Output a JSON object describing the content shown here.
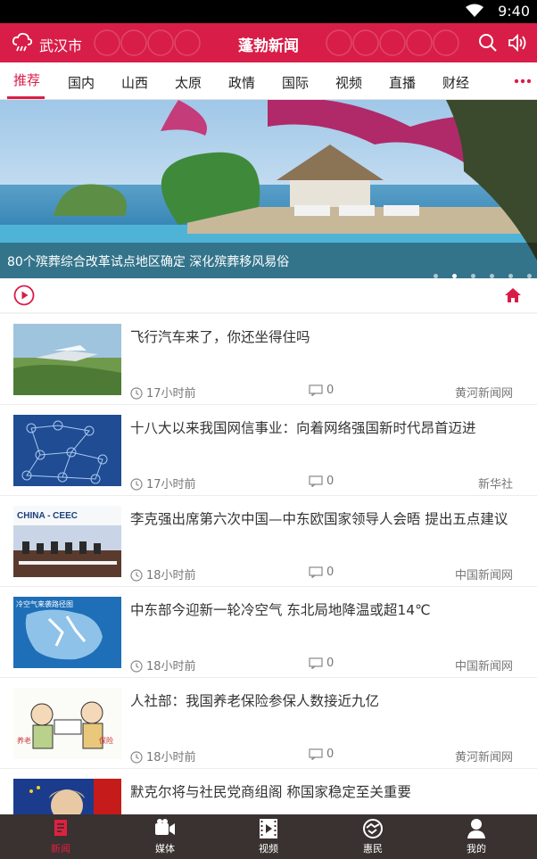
{
  "status": {
    "time": "9:40"
  },
  "header": {
    "city": "武汉市",
    "title": "蓬勃新闻"
  },
  "tabs": [
    {
      "label": "推荐",
      "active": true
    },
    {
      "label": "国内"
    },
    {
      "label": "山西"
    },
    {
      "label": "太原"
    },
    {
      "label": "政情"
    },
    {
      "label": "国际"
    },
    {
      "label": "视频"
    },
    {
      "label": "直播"
    },
    {
      "label": "财经"
    }
  ],
  "banner": {
    "caption": "80个殡葬综合改革试点地区确定 深化殡葬移风易俗",
    "dot_count": 6,
    "active_dot": 2
  },
  "news": [
    {
      "title": "飞行汽车来了，你还坐得住吗",
      "time": "17小时前",
      "comments": "0",
      "source": "黄河新闻网"
    },
    {
      "title": "十八大以来我国网信事业：向着网络强国新时代昂首迈进",
      "time": "17小时前",
      "comments": "0",
      "source": "新华社"
    },
    {
      "title": "李克强出席第六次中国—中东欧国家领导人会晤 提出五点建议",
      "time": "18小时前",
      "comments": "0",
      "source": "中国新闻网"
    },
    {
      "title": "中东部今迎新一轮冷空气 东北局地降温或超14℃",
      "time": "18小时前",
      "comments": "0",
      "source": "中国新闻网"
    },
    {
      "title": "人社部：我国养老保险参保人数接近九亿",
      "time": "18小时前",
      "comments": "0",
      "source": "黄河新闻网"
    },
    {
      "title": "默克尔将与社民党商组阁 称国家稳定至关重要"
    }
  ],
  "thumb_texts": {
    "ceec": "CHINA - CEEC",
    "map": "冷空气来袭路径图",
    "sign1": "养老",
    "sign2": "保险"
  },
  "bottom_nav": [
    {
      "label": "新闻",
      "active": true
    },
    {
      "label": "媒体"
    },
    {
      "label": "视频"
    },
    {
      "label": "惠民"
    },
    {
      "label": "我的"
    }
  ],
  "colors": {
    "brand": "#d81e48",
    "nav_bg": "#3a3131"
  }
}
